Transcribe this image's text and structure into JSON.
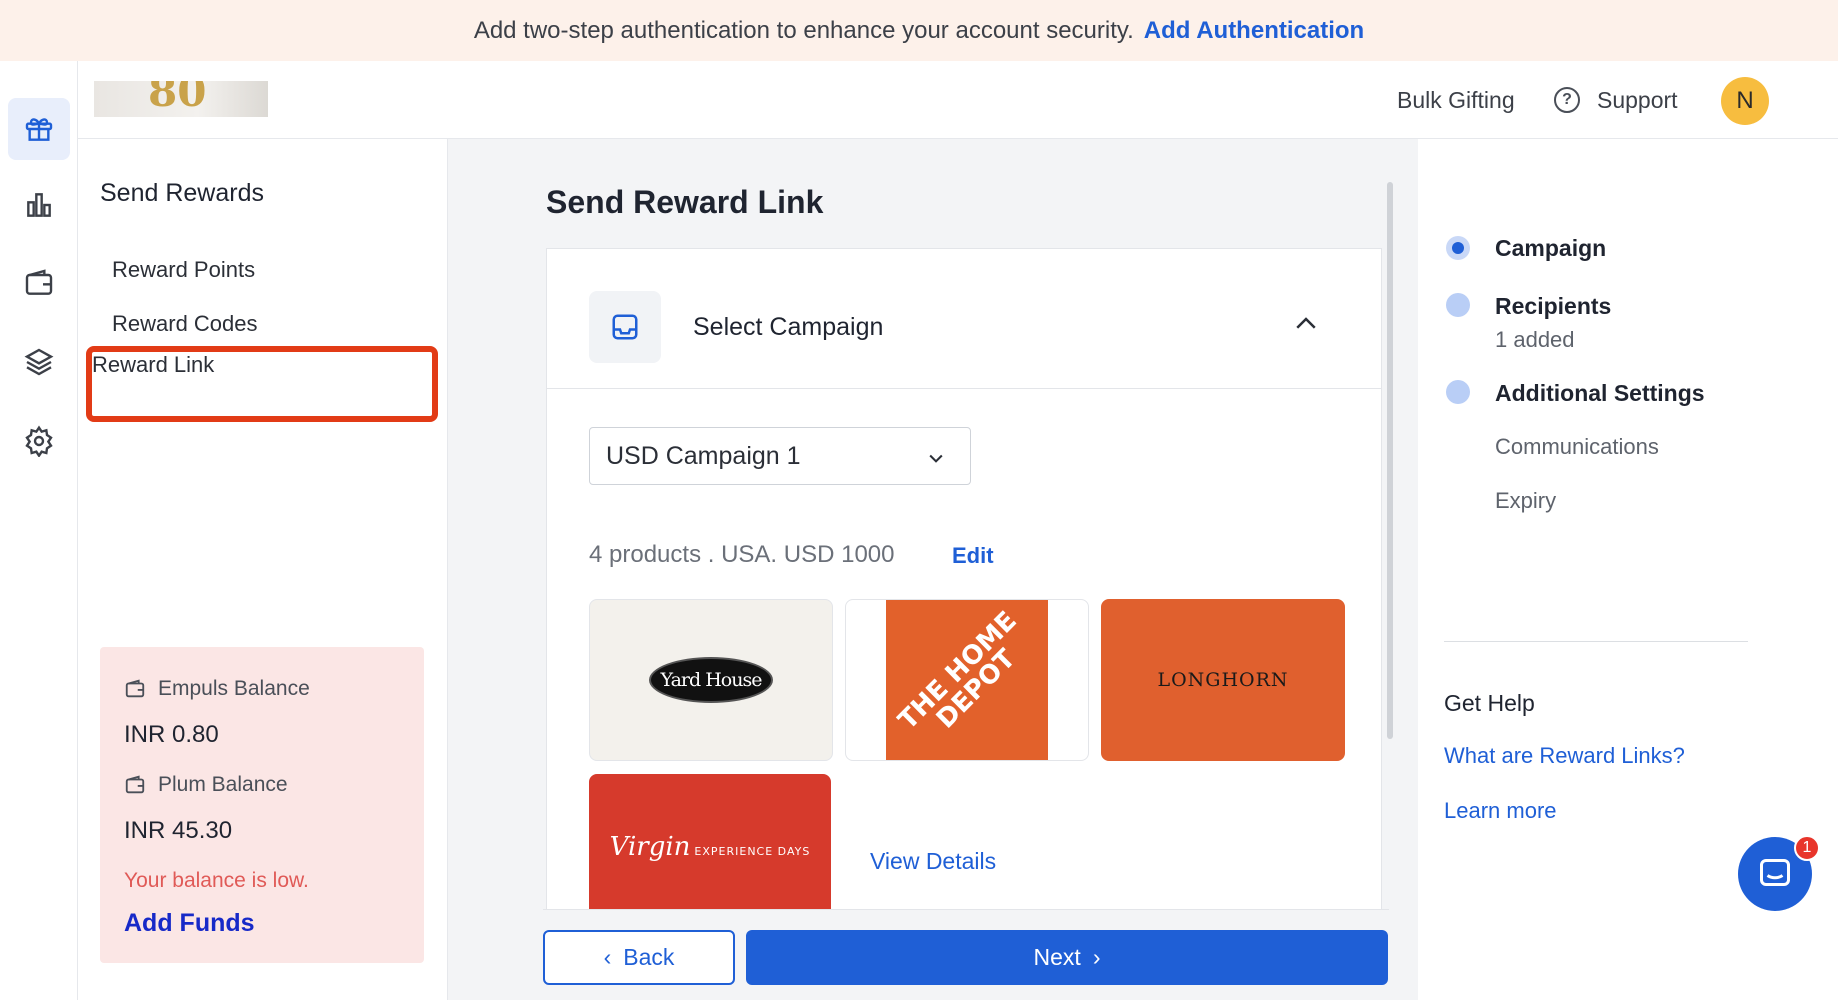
{
  "banner": {
    "message": "Add two-step authentication to enhance your account security.",
    "link": "Add Authentication"
  },
  "rail": {
    "items": [
      "gift-icon",
      "chart-icon",
      "wallet-icon",
      "layers-icon",
      "settings-icon"
    ],
    "active": "gift-icon"
  },
  "topbar": {
    "logo_text": "80",
    "bulk_gifting": "Bulk Gifting",
    "support": "Support",
    "avatar_initial": "N"
  },
  "sidebar": {
    "title": "Send Rewards",
    "items": [
      {
        "label": "Reward Points"
      },
      {
        "label": "Reward Codes"
      },
      {
        "label": "Reward Link"
      }
    ],
    "active_item": "Reward Link"
  },
  "balance": {
    "empuls_label": "Empuls Balance",
    "empuls_value": "INR 0.80",
    "plum_label": "Plum Balance",
    "plum_value": "INR 45.30",
    "low_warning": "Your balance is low.",
    "add_funds": "Add Funds"
  },
  "main": {
    "title": "Send Reward Link",
    "card_title": "Select Campaign",
    "campaign_select": "USD Campaign 1",
    "summary": "4 products . USA. USD 1000",
    "edit": "Edit",
    "products": [
      {
        "name": "Yard House"
      },
      {
        "name": "THE HOME DEPOT"
      },
      {
        "name": "LONGHORN"
      },
      {
        "name": "Virgin",
        "sub": "EXPERIENCE DAYS"
      }
    ],
    "view_details": "View Details",
    "back": "Back",
    "next": "Next"
  },
  "steps": {
    "items": [
      {
        "label": "Campaign"
      },
      {
        "label": "Recipients",
        "sub": "1 added"
      },
      {
        "label": "Additional Settings"
      }
    ],
    "subitems": [
      "Communications",
      "Expiry"
    ],
    "active_step": "Campaign"
  },
  "help": {
    "title": "Get Help",
    "links": [
      "What are Reward Links?",
      "Learn more"
    ]
  },
  "chat": {
    "badge": "1"
  },
  "colors": {
    "accent": "#1f5fd6",
    "banner_bg": "#fdf1ea",
    "highlight_border": "#e23b16",
    "balance_bg": "#fbe6e5",
    "low_text": "#e05a57"
  }
}
